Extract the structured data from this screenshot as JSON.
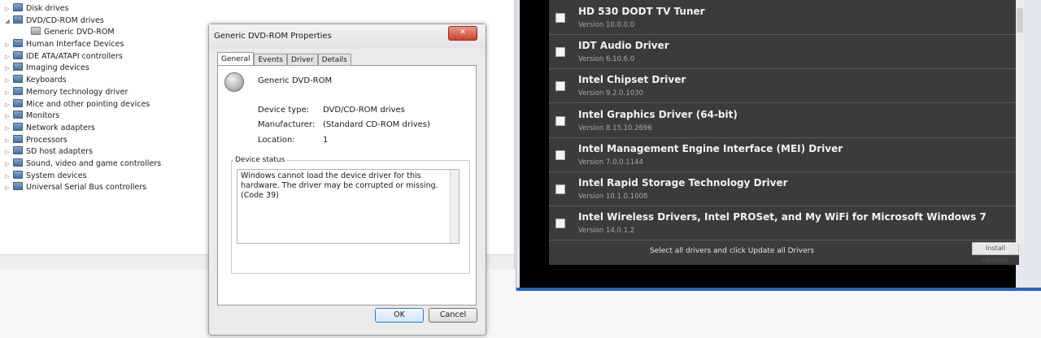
{
  "device_manager": {
    "items": [
      {
        "label": "Disk drives",
        "expanded": false
      },
      {
        "label": "DVD/CD-ROM drives",
        "expanded": true
      },
      {
        "label": "Generic DVD-ROM",
        "child": true
      },
      {
        "label": "Human Interface Devices",
        "expanded": false
      },
      {
        "label": "IDE ATA/ATAPI controllers",
        "expanded": false
      },
      {
        "label": "Imaging devices",
        "expanded": false
      },
      {
        "label": "Keyboards",
        "expanded": false
      },
      {
        "label": "Memory technology driver",
        "expanded": false
      },
      {
        "label": "Mice and other pointing devices",
        "expanded": false
      },
      {
        "label": "Monitors",
        "expanded": false
      },
      {
        "label": "Network adapters",
        "expanded": false
      },
      {
        "label": "Processors",
        "expanded": false
      },
      {
        "label": "SD host adapters",
        "expanded": false
      },
      {
        "label": "Sound, video and game controllers",
        "expanded": false
      },
      {
        "label": "System devices",
        "expanded": false
      },
      {
        "label": "Universal Serial Bus controllers",
        "expanded": false
      }
    ]
  },
  "dialog": {
    "title": "Generic DVD-ROM Properties",
    "close": "✕",
    "tabs": [
      "General",
      "Events",
      "Driver",
      "Details"
    ],
    "device_name": "Generic DVD-ROM",
    "props": [
      {
        "label": "Device type:",
        "value": "DVD/CD-ROM drives"
      },
      {
        "label": "Manufacturer:",
        "value": "(Standard CD-ROM drives)"
      },
      {
        "label": "Location:",
        "value": "1"
      }
    ],
    "status_label": "Device status",
    "status_text": "Windows cannot load the device driver for this hardware. The driver may be corrupted or missing. (Code 39)",
    "ok": "OK",
    "cancel": "Cancel"
  },
  "drivers": {
    "items": [
      {
        "name": "HD 530 DODT TV Tuner",
        "version": "Version 10.0.0.0"
      },
      {
        "name": "IDT Audio Driver",
        "version": "Version 6.10.6.0"
      },
      {
        "name": "Intel Chipset Driver",
        "version": "Version 9.2.0.1030"
      },
      {
        "name": "Intel Graphics Driver (64-bit)",
        "version": "Version 8.15.10.2696"
      },
      {
        "name": "Intel Management Engine Interface (MEI) Driver",
        "version": "Version 7.0.0.1144"
      },
      {
        "name": "Intel Rapid Storage Technology Driver",
        "version": "Version 10.1.0.1008"
      },
      {
        "name": "Intel Wireless Drivers, Intel PROSet, and My WiFi for Microsoft Windows 7",
        "version": "Version 14.0.1.2"
      }
    ],
    "footer": "Select all drivers and click Update all Drivers",
    "footer_button": "Install Updates",
    "colors": {
      "list_bg": "#3b3b3d",
      "accent": "#2f5fb3"
    }
  }
}
